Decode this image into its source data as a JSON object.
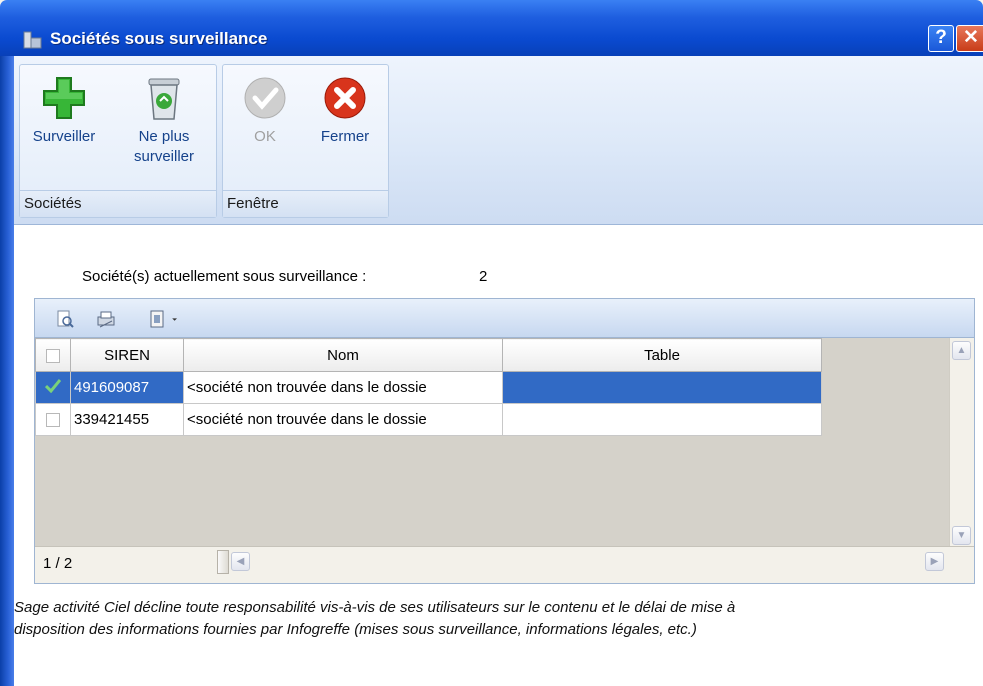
{
  "window": {
    "title": "Sociétés sous surveillance",
    "help_label": "?",
    "close_label": "✕"
  },
  "ribbon": {
    "groups": [
      {
        "label": "Sociétés",
        "buttons": [
          {
            "label": "Surveiller",
            "icon": "plus-icon"
          },
          {
            "label": "Ne plus surveiller",
            "icon": "recycle-bin-icon"
          }
        ]
      },
      {
        "label": "Fenêtre",
        "buttons": [
          {
            "label": "OK",
            "icon": "check-icon",
            "disabled": true
          },
          {
            "label": "Fermer",
            "icon": "close-red-icon"
          }
        ]
      }
    ]
  },
  "summary": {
    "label": "Société(s) actuellement sous surveillance :",
    "count": "2"
  },
  "grid": {
    "columns": [
      "SIREN",
      "Nom",
      "Table"
    ],
    "rows": [
      {
        "checked": true,
        "selected": true,
        "siren": "491609087",
        "nom": "<société non trouvée dans le dossie",
        "table": ""
      },
      {
        "checked": false,
        "selected": false,
        "siren": "339421455",
        "nom": "<société non trouvée dans le dossie",
        "table": ""
      }
    ],
    "page_indicator": "1 / 2"
  },
  "disclaimer": {
    "line1": "Sage activité Ciel décline toute responsabilité vis-à-vis de ses utilisateurs sur le contenu et le délai de mise à",
    "line2": "disposition des informations fournies par Infogreffe (mises sous surveillance, informations légales, etc.)"
  },
  "colors": {
    "titlebar": "#0a4ad0",
    "selection": "#316ac5",
    "close_red": "#d8341c",
    "plus_green": "#2ea12e"
  }
}
